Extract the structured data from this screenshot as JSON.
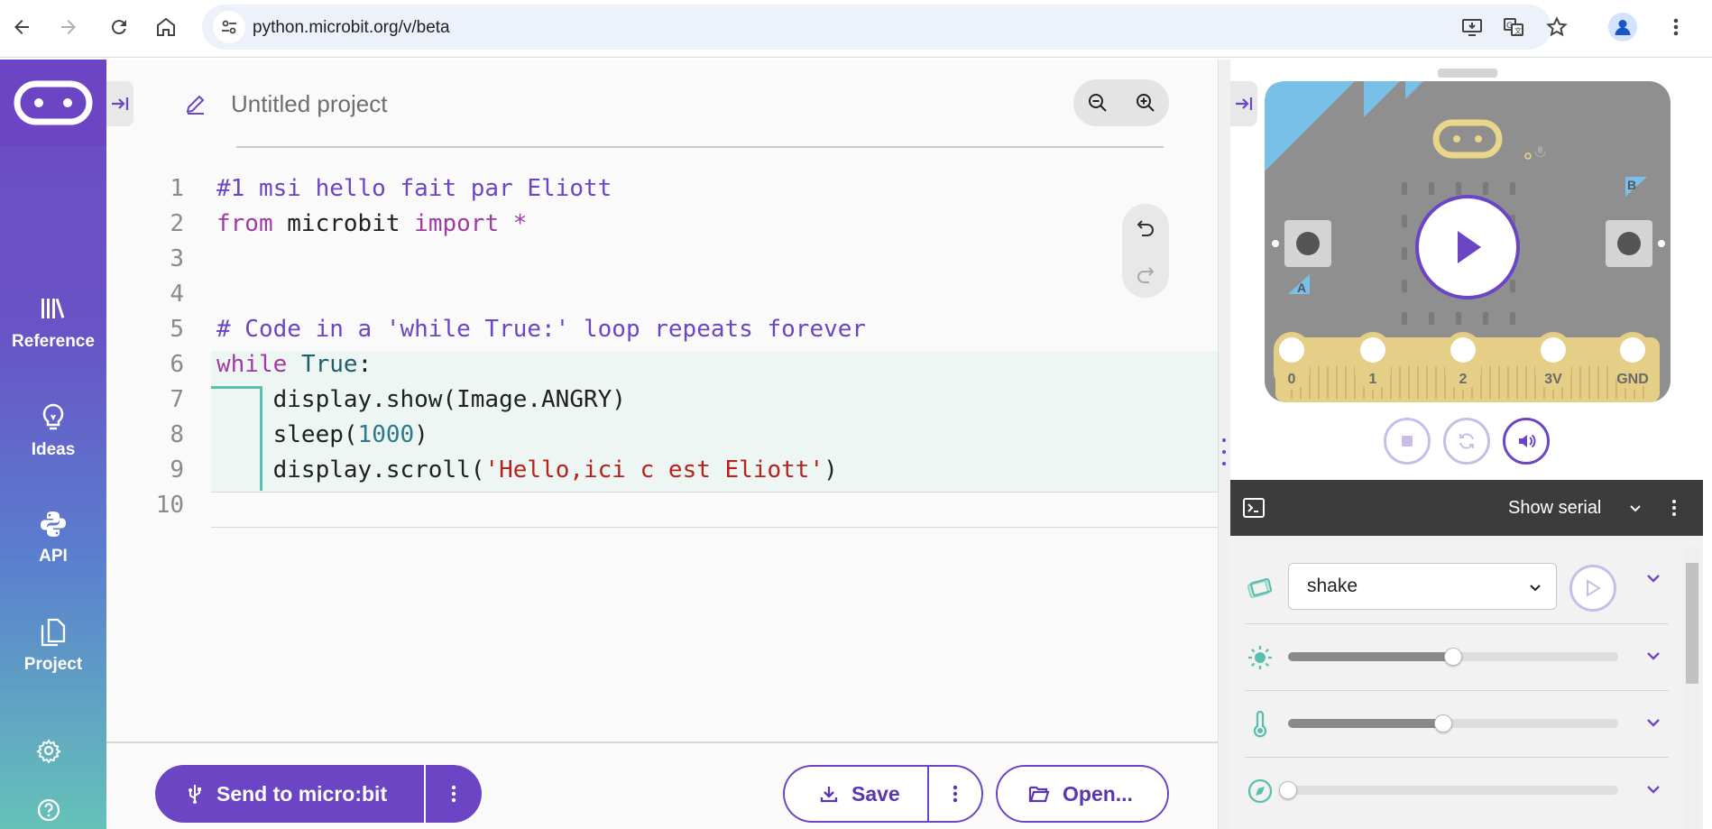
{
  "browser": {
    "url": "python.microbit.org/v/beta"
  },
  "nav": {
    "items": [
      {
        "label": "Reference",
        "icon": "reference-icon"
      },
      {
        "label": "Ideas",
        "icon": "lightbulb-icon"
      },
      {
        "label": "API",
        "icon": "python-icon"
      },
      {
        "label": "Project",
        "icon": "files-icon"
      }
    ]
  },
  "editor": {
    "project_name": "Untitled project",
    "lines": [
      {
        "n": "1",
        "parts": [
          {
            "t": "#1 msi hello fait par Eliott",
            "c": "comment"
          }
        ]
      },
      {
        "n": "2",
        "parts": [
          {
            "t": "from",
            "c": "kw"
          },
          {
            "t": " microbit ",
            "c": ""
          },
          {
            "t": "import",
            "c": "kw"
          },
          {
            "t": " *",
            "c": "kw"
          }
        ]
      },
      {
        "n": "3",
        "parts": []
      },
      {
        "n": "4",
        "parts": []
      },
      {
        "n": "5",
        "parts": [
          {
            "t": "# Code in a 'while True:' loop repeats forever",
            "c": "comment"
          }
        ]
      },
      {
        "n": "6",
        "parts": [
          {
            "t": "while",
            "c": "kw"
          },
          {
            "t": " ",
            "c": ""
          },
          {
            "t": "True",
            "c": "builtin"
          },
          {
            "t": ":",
            "c": ""
          }
        ]
      },
      {
        "n": "7",
        "parts": [
          {
            "t": "    display.show(Image.ANGRY)",
            "c": ""
          }
        ]
      },
      {
        "n": "8",
        "parts": [
          {
            "t": "    sleep(",
            "c": ""
          },
          {
            "t": "1000",
            "c": "num"
          },
          {
            "t": ")",
            "c": ""
          }
        ]
      },
      {
        "n": "9",
        "parts": [
          {
            "t": "    display.scroll(",
            "c": ""
          },
          {
            "t": "'Hello,ici c est Eliott'",
            "c": "str"
          },
          {
            "t": ")",
            "c": ""
          }
        ]
      },
      {
        "n": "10",
        "parts": []
      }
    ]
  },
  "toolbar": {
    "send_label": "Send to micro:bit",
    "save_label": "Save",
    "open_label": "Open..."
  },
  "simulator": {
    "pin_labels": [
      "0",
      "1",
      "2",
      "3V",
      "GND"
    ],
    "button_a": "A",
    "button_b": "B"
  },
  "serial": {
    "label": "Show serial"
  },
  "sensors": {
    "gesture_value": "shake",
    "light_level": 0.5,
    "temperature_level": 0.47,
    "compass_level": 0.0
  },
  "colors": {
    "brand_purple": "#6b45c4",
    "accent_teal": "#5bbfad"
  }
}
